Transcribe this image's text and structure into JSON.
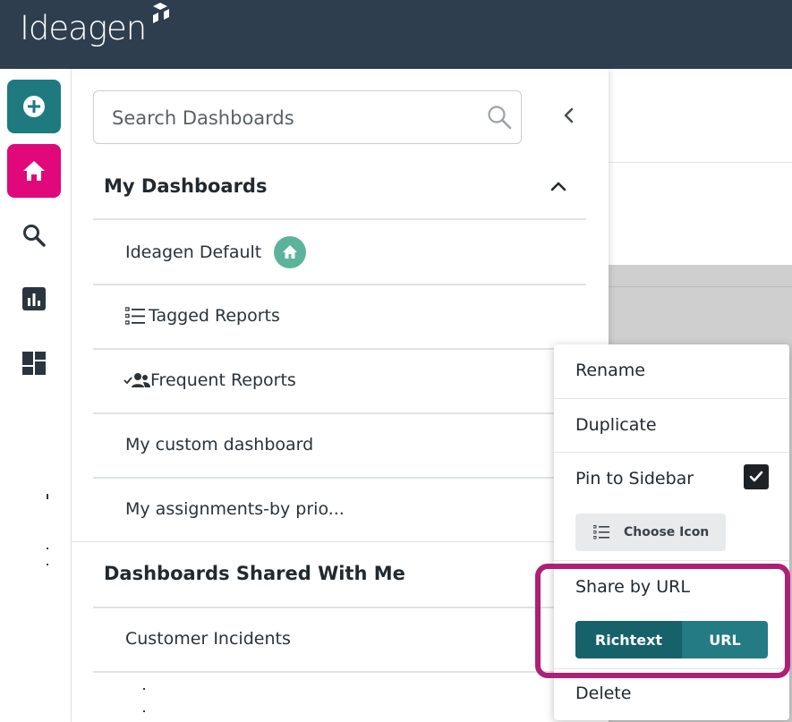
{
  "brand": {
    "name": "Ideagen",
    "header_color": "#2e3e4f"
  },
  "rail": {
    "items": [
      {
        "icon": "plus-icon",
        "color": "#1f7a80"
      },
      {
        "icon": "home-icon",
        "color": "#e0087a"
      },
      {
        "icon": "search-icon"
      },
      {
        "icon": "bar-chart-icon"
      },
      {
        "icon": "dashboard-icon"
      }
    ]
  },
  "search": {
    "placeholder": "Search Dashboards"
  },
  "sections": {
    "my": {
      "title": "My Dashboards",
      "items": [
        "Ideagen Default",
        "Tagged Reports",
        "Frequent Reports",
        "My custom dashboard",
        "My assignments-by prio..."
      ]
    },
    "shared": {
      "title": "Dashboards Shared With Me",
      "items": [
        "Customer Incidents"
      ]
    }
  },
  "menu": {
    "rename": "Rename",
    "duplicate": "Duplicate",
    "pin": "Pin to Sidebar",
    "pin_checked": true,
    "choose_icon": "Choose Icon",
    "share": "Share by URL",
    "richtext": "Richtext",
    "url": "URL",
    "delete": "Delete"
  },
  "colors": {
    "accent": "#1f7a80",
    "highlight": "#b01f76",
    "home_badge": "#5cb39c"
  }
}
